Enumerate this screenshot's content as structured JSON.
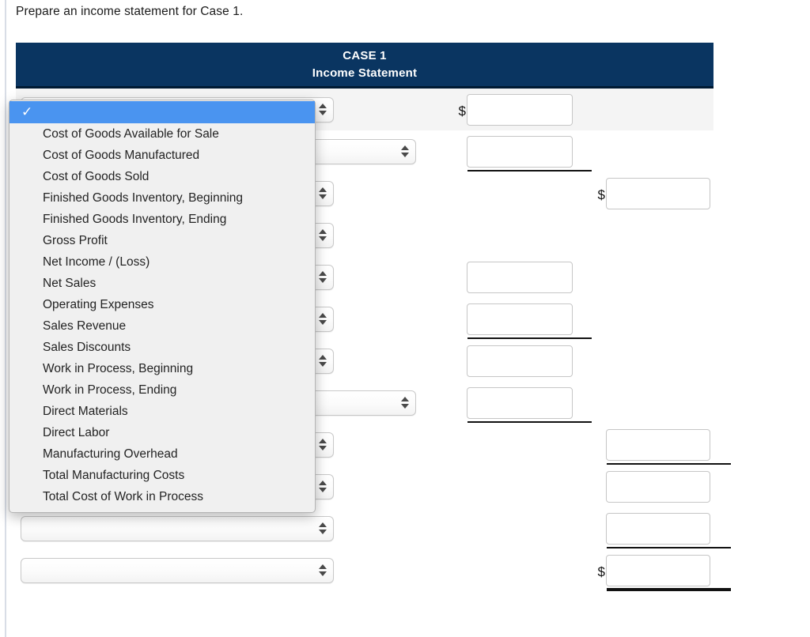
{
  "prompt": "Prepare an income statement for Case 1.",
  "statement": {
    "title_line1": "CASE 1",
    "title_line2": "Income Statement",
    "currency_symbol": "$",
    "rows": [
      {
        "shaded": true,
        "select": "narrow",
        "value": "",
        "col2": true,
        "col2_dollar": true,
        "col2_rule": "none",
        "col3": false,
        "col3_dollar": false,
        "col3_rule": "none"
      },
      {
        "shaded": false,
        "select": "wide",
        "value": "",
        "col2": true,
        "col2_dollar": false,
        "col2_rule": "single",
        "col3": false,
        "col3_dollar": false,
        "col3_rule": "none"
      },
      {
        "shaded": false,
        "select": "narrow",
        "value": "",
        "col2": false,
        "col2_dollar": false,
        "col2_rule": "none",
        "col3": true,
        "col3_dollar": true,
        "col3_rule": "none"
      },
      {
        "shaded": false,
        "select": "narrow",
        "value": "",
        "col2": false,
        "col2_dollar": false,
        "col2_rule": "none",
        "col3": false,
        "col3_dollar": false,
        "col3_rule": "none"
      },
      {
        "shaded": false,
        "select": "narrow",
        "value": "",
        "col2": true,
        "col2_dollar": false,
        "col2_rule": "none",
        "col3": false,
        "col3_dollar": false,
        "col3_rule": "none"
      },
      {
        "shaded": false,
        "select": "narrow",
        "value": "",
        "col2": true,
        "col2_dollar": false,
        "col2_rule": "single",
        "col3": false,
        "col3_dollar": false,
        "col3_rule": "none"
      },
      {
        "shaded": false,
        "select": "narrow",
        "value": "",
        "col2": true,
        "col2_dollar": false,
        "col2_rule": "none",
        "col3": false,
        "col3_dollar": false,
        "col3_rule": "none"
      },
      {
        "shaded": false,
        "select": "wide",
        "value": "",
        "col2": true,
        "col2_dollar": false,
        "col2_rule": "single",
        "col3": false,
        "col3_dollar": false,
        "col3_rule": "none"
      },
      {
        "shaded": false,
        "select": "narrow",
        "value": "",
        "col2": false,
        "col2_dollar": false,
        "col2_rule": "none",
        "col3": true,
        "col3_dollar": false,
        "col3_rule": "single"
      },
      {
        "shaded": false,
        "select": "narrow",
        "value": "",
        "col2": false,
        "col2_dollar": false,
        "col2_rule": "none",
        "col3": true,
        "col3_dollar": false,
        "col3_rule": "none"
      },
      {
        "shaded": false,
        "select": "narrow",
        "value": "",
        "col2": false,
        "col2_dollar": false,
        "col2_rule": "none",
        "col3": true,
        "col3_dollar": false,
        "col3_rule": "single"
      },
      {
        "shaded": false,
        "select": "narrow",
        "value": "",
        "col2": false,
        "col2_dollar": false,
        "col2_rule": "none",
        "col3": true,
        "col3_dollar": true,
        "col3_rule": "double"
      }
    ]
  },
  "dropdown": {
    "selected_label": "",
    "check_glyph": "✓",
    "options": [
      "Cost of Goods Available for Sale",
      "Cost of Goods Manufactured",
      "Cost of Goods Sold",
      "Finished Goods Inventory, Beginning",
      "Finished Goods Inventory, Ending",
      "Gross Profit",
      "Net Income / (Loss)",
      "Net Sales",
      "Operating Expenses",
      "Sales Revenue",
      "Sales Discounts",
      "Work in Process, Beginning",
      "Work in Process, Ending",
      "Direct Materials",
      "Direct Labor",
      "Manufacturing Overhead",
      "Total Manufacturing Costs",
      "Total Cost of Work in Process"
    ]
  },
  "colors": {
    "header_navy": "#0a3561",
    "header_underline": "#001a33",
    "row_shade": "#f4f4f4",
    "menu_highlight": "#4a94f0",
    "menu_background": "#f0f0f0"
  }
}
